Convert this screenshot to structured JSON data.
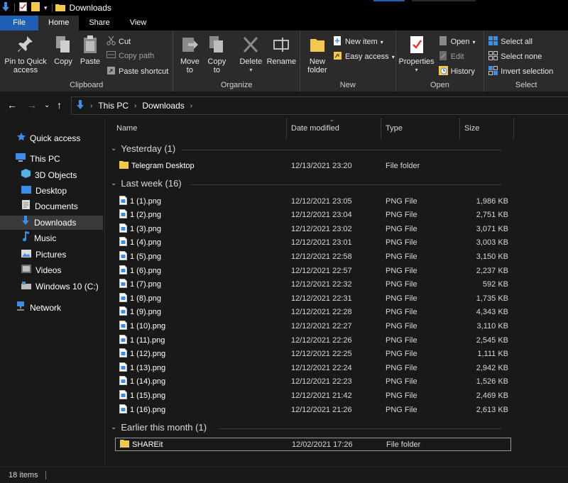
{
  "window": {
    "title": "Downloads"
  },
  "tabs": [
    {
      "label": "File"
    },
    {
      "label": "Home"
    },
    {
      "label": "Share"
    },
    {
      "label": "View"
    }
  ],
  "ribbon": {
    "clipboard": {
      "label": "Clipboard",
      "pin": "Pin to Quick access",
      "copy": "Copy",
      "paste": "Paste",
      "cut": "Cut",
      "copy_path": "Copy path",
      "paste_shortcut": "Paste shortcut"
    },
    "organize": {
      "label": "Organize",
      "move_to": "Move to",
      "copy_to": "Copy to",
      "delete": "Delete",
      "rename": "Rename"
    },
    "new": {
      "label": "New",
      "new_folder": "New folder",
      "new_item": "New item",
      "easy_access": "Easy access"
    },
    "open": {
      "label": "Open",
      "properties": "Properties",
      "open": "Open",
      "edit": "Edit",
      "history": "History"
    },
    "select": {
      "label": "Select",
      "select_all": "Select all",
      "select_none": "Select none",
      "invert_selection": "Invert selection"
    }
  },
  "address": {
    "crumbs": [
      "This PC",
      "Downloads"
    ]
  },
  "nav": {
    "quick_access": "Quick access",
    "this_pc": "This PC",
    "objects3d": "3D Objects",
    "desktop": "Desktop",
    "documents": "Documents",
    "downloads": "Downloads",
    "music": "Music",
    "pictures": "Pictures",
    "videos": "Videos",
    "windows_c": "Windows 10 (C:)",
    "network": "Network"
  },
  "columns": {
    "name": "Name",
    "date": "Date modified",
    "type": "Type",
    "size": "Size"
  },
  "groups": {
    "yesterday": "Yesterday (1)",
    "last_week": "Last week (16)",
    "earlier": "Earlier this month (1)"
  },
  "files": {
    "yesterday": [
      {
        "name": "Telegram Desktop",
        "date": "12/13/2021 23:20",
        "type": "File folder",
        "size": ""
      }
    ],
    "last_week": [
      {
        "name": "1 (1).png",
        "date": "12/12/2021 23:05",
        "type": "PNG File",
        "size": "1,986 KB"
      },
      {
        "name": "1 (2).png",
        "date": "12/12/2021 23:04",
        "type": "PNG File",
        "size": "2,751 KB"
      },
      {
        "name": "1 (3).png",
        "date": "12/12/2021 23:02",
        "type": "PNG File",
        "size": "3,071 KB"
      },
      {
        "name": "1 (4).png",
        "date": "12/12/2021 23:01",
        "type": "PNG File",
        "size": "3,003 KB"
      },
      {
        "name": "1 (5).png",
        "date": "12/12/2021 22:58",
        "type": "PNG File",
        "size": "3,150 KB"
      },
      {
        "name": "1 (6).png",
        "date": "12/12/2021 22:57",
        "type": "PNG File",
        "size": "2,237 KB"
      },
      {
        "name": "1 (7).png",
        "date": "12/12/2021 22:32",
        "type": "PNG File",
        "size": "592 KB"
      },
      {
        "name": "1 (8).png",
        "date": "12/12/2021 22:31",
        "type": "PNG File",
        "size": "1,735 KB"
      },
      {
        "name": "1 (9).png",
        "date": "12/12/2021 22:28",
        "type": "PNG File",
        "size": "4,343 KB"
      },
      {
        "name": "1 (10).png",
        "date": "12/12/2021 22:27",
        "type": "PNG File",
        "size": "3,110 KB"
      },
      {
        "name": "1 (11).png",
        "date": "12/12/2021 22:26",
        "type": "PNG File",
        "size": "2,545 KB"
      },
      {
        "name": "1 (12).png",
        "date": "12/12/2021 22:25",
        "type": "PNG File",
        "size": "1,111 KB"
      },
      {
        "name": "1 (13).png",
        "date": "12/12/2021 22:24",
        "type": "PNG File",
        "size": "2,942 KB"
      },
      {
        "name": "1 (14).png",
        "date": "12/12/2021 22:23",
        "type": "PNG File",
        "size": "1,526 KB"
      },
      {
        "name": "1 (15).png",
        "date": "12/12/2021 21:42",
        "type": "PNG File",
        "size": "2,469 KB"
      },
      {
        "name": "1 (16).png",
        "date": "12/12/2021 21:26",
        "type": "PNG File",
        "size": "2,613 KB"
      }
    ],
    "earlier": [
      {
        "name": "SHAREit",
        "date": "12/02/2021 17:26",
        "type": "File folder",
        "size": ""
      }
    ]
  },
  "status": {
    "items": "18 items"
  },
  "colors": {
    "accent": "#1f5fb4",
    "folder": "#f2c94c",
    "background": "#191919",
    "ribbon": "#2b2b2b"
  }
}
